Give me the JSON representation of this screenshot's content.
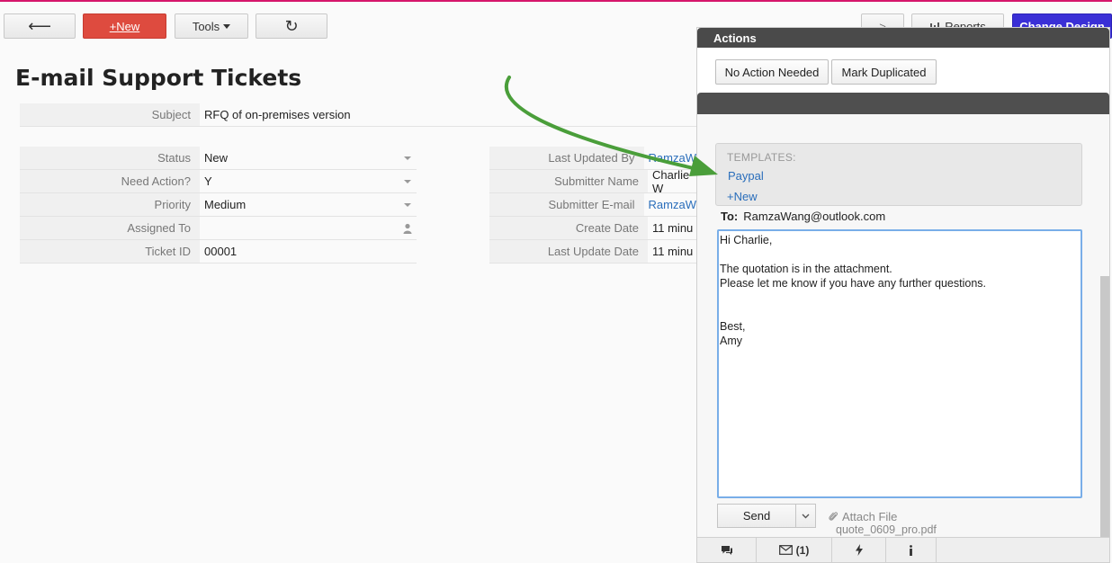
{
  "toolbar": {
    "back_label": "⟵",
    "new_label": "+New",
    "tools_label": "Tools",
    "refresh_label": "↻",
    "next_label": ">",
    "reports_label": "Reports",
    "change_design_label": "Change Design"
  },
  "page": {
    "title": "E-mail Support Tickets"
  },
  "subject": {
    "label": "Subject",
    "value": "RFQ of on-premises version"
  },
  "left_fields": [
    {
      "label": "Status",
      "value": "New"
    },
    {
      "label": "Need Action?",
      "value": "Y"
    },
    {
      "label": "Priority",
      "value": "Medium"
    },
    {
      "label": "Assigned To",
      "value": ""
    },
    {
      "label": "Ticket ID",
      "value": "00001"
    }
  ],
  "right_fields": [
    {
      "label": "Last Updated By",
      "value": "RamzaW"
    },
    {
      "label": "Submitter Name",
      "value": "Charlie W"
    },
    {
      "label": "Submitter E-mail",
      "value": "RamzaW"
    },
    {
      "label": "Create Date",
      "value": "11 minu"
    },
    {
      "label": "Last Update Date",
      "value": "11 minu"
    }
  ],
  "panel": {
    "title": "Actions",
    "actions": [
      "No Action Needed",
      "Mark Duplicated"
    ],
    "templates_title": "TEMPLATES:",
    "template_item": "Paypal",
    "template_new": "+New",
    "to_label": "To:",
    "to_value": "RamzaWang@outlook.com",
    "body": "Hi Charlie,\n\nThe quotation is in the attachment.\nPlease let me know if you have any further questions.\n\n\nBest,\nAmy",
    "send_label": "Send",
    "attach_label": "Attach File",
    "attached_file": "quote_0609_pro.pdf",
    "footer_mail_count": "(1)"
  },
  "colors": {
    "new_button": "#de4b3f",
    "change_design_button": "#3a2fd6",
    "arrow": "#4a9e3a",
    "link": "#2a6ebb"
  }
}
